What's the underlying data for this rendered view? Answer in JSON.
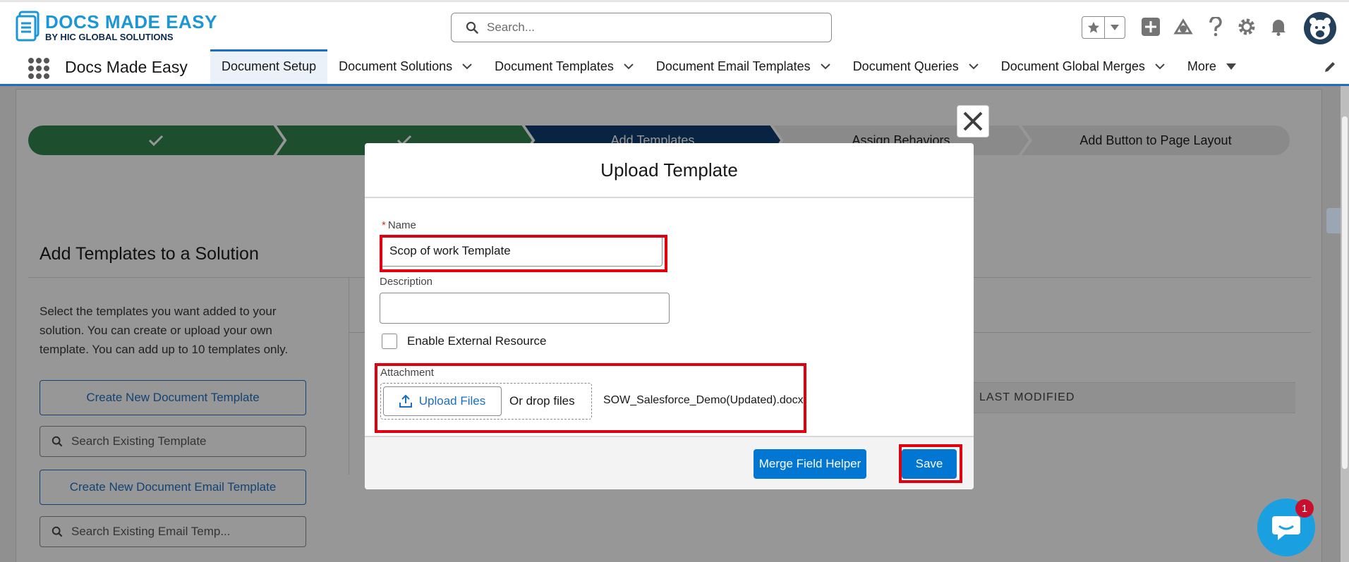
{
  "header": {
    "logo_title": "DOCS MADE EASY",
    "logo_subtitle": "BY HIC GLOBAL SOLUTIONS",
    "search_placeholder": "Search..."
  },
  "nav": {
    "app_name": "Docs Made Easy",
    "tabs": [
      {
        "label": "Document Setup",
        "active": true
      },
      {
        "label": "Document Solutions"
      },
      {
        "label": "Document Templates"
      },
      {
        "label": "Document Email Templates"
      },
      {
        "label": "Document Queries"
      },
      {
        "label": "Document Global Merges"
      },
      {
        "label": "More"
      }
    ]
  },
  "path": {
    "steps": [
      "",
      "",
      "Add Templates",
      "Assign Behaviors",
      "Add Button to Page Layout"
    ]
  },
  "page": {
    "section_title": "Add Templates to a Solution",
    "intro": "Select the templates you want added to your solution. You can create or upload your own template. You can add up to 10 templates only.",
    "create_template_btn": "Create New Document Template",
    "search_template_placeholder": "Search Existing Template",
    "create_email_template_btn": "Create New Document Email Template",
    "search_email_placeholder": "Search Existing Email Temp...",
    "column_last_modified": "LAST MODIFIED"
  },
  "modal": {
    "title": "Upload Template",
    "name_label": "Name",
    "name_value": "Scop of work Template",
    "description_label": "Description",
    "description_value": "",
    "external_resource_label": "Enable External Resource",
    "external_resource_checked": false,
    "attachment_label": "Attachment",
    "upload_button": "Upload Files",
    "drop_text": "Or drop files",
    "file_name": "SOW_Salesforce_Demo(Updated).docx",
    "merge_field_button": "Merge Field Helper",
    "save_button": "Save"
  },
  "chat": {
    "badge_count": "1"
  },
  "colors": {
    "brand": "#0176d3",
    "path_done": "#2e844a",
    "path_current": "#0b3a6e",
    "highlight": "#e0000f"
  }
}
